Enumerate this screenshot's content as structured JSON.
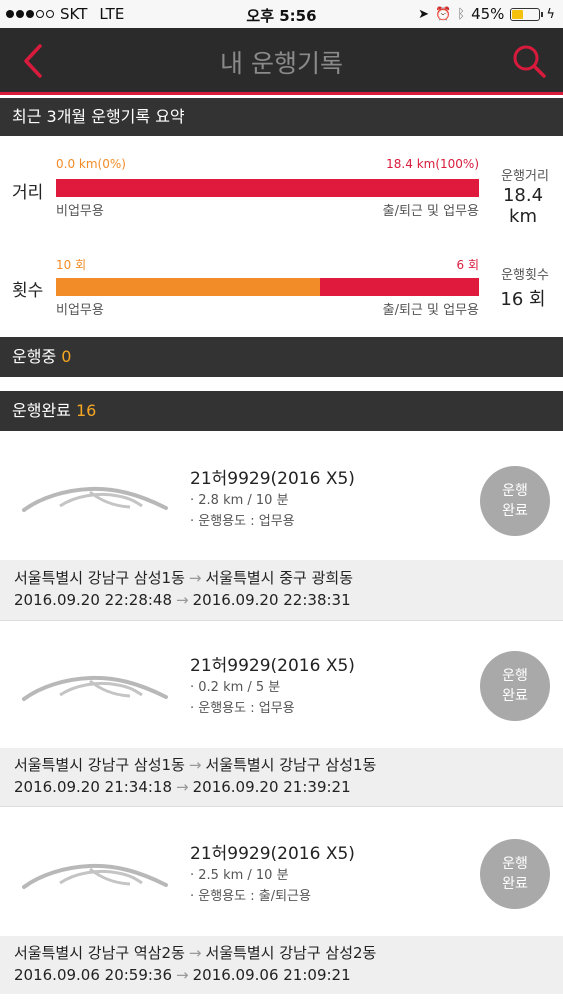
{
  "status": {
    "carrier": "SKT",
    "network": "LTE",
    "time": "오후 5:56",
    "battery": "45%",
    "battery_level": 0.45
  },
  "nav": {
    "title": "내 운행기록"
  },
  "summary": {
    "header": "최근 3개월 운행기록 요약",
    "distance": {
      "label": "거리",
      "left_value": "0.0 km(0%)",
      "right_value": "18.4 km(100%)",
      "left_caption": "비업무용",
      "right_caption": "출/퇴근 및 업무용",
      "side_caption": "운행거리",
      "side_value": "18.4 km",
      "fraction_left": 0.0
    },
    "count": {
      "label": "횟수",
      "left_value": "10 회",
      "right_value": "6 회",
      "left_caption": "비업무용",
      "right_caption": "출/퇴근 및 업무용",
      "side_caption": "운행횟수",
      "side_value": "16 회",
      "fraction_left": 0.625
    }
  },
  "in_progress": {
    "label": "운행중",
    "count": "0"
  },
  "completed": {
    "label": "운행완료",
    "count": "16"
  },
  "trips": [
    {
      "car": "21허9929(2016 X5)",
      "distance_time": "· 2.8 km / 10 분",
      "usage": "· 운행용도 : 업무용",
      "badge_line1": "운행",
      "badge_line2": "완료",
      "from": "서울특별시 강남구 삼성1동",
      "to": "서울특별시 중구 광희동",
      "start": "2016.09.20 22:28:48",
      "end": "2016.09.20 22:38:31"
    },
    {
      "car": "21허9929(2016 X5)",
      "distance_time": "· 0.2 km / 5 분",
      "usage": "· 운행용도 : 업무용",
      "badge_line1": "운행",
      "badge_line2": "완료",
      "from": "서울특별시 강남구 삼성1동",
      "to": "서울특별시 강남구 삼성1동",
      "start": "2016.09.20 21:34:18",
      "end": "2016.09.20 21:39:21"
    },
    {
      "car": "21허9929(2016 X5)",
      "distance_time": "· 2.5 km / 10 분",
      "usage": "· 운행용도 : 출/퇴근용",
      "badge_line1": "운행",
      "badge_line2": "완료",
      "from": "서울특별시 강남구 역삼2동",
      "to": "서울특별시 강남구 삼성2동",
      "start": "2016.09.06 20:59:36",
      "end": "2016.09.06 21:09:21"
    }
  ],
  "arrow_glyph": "→",
  "colors": {
    "accent": "#d81b3c",
    "orange": "#f28c28",
    "header_bg": "#333333",
    "nav_bg": "#2b2b2b",
    "badge": "#a9a9a9"
  }
}
